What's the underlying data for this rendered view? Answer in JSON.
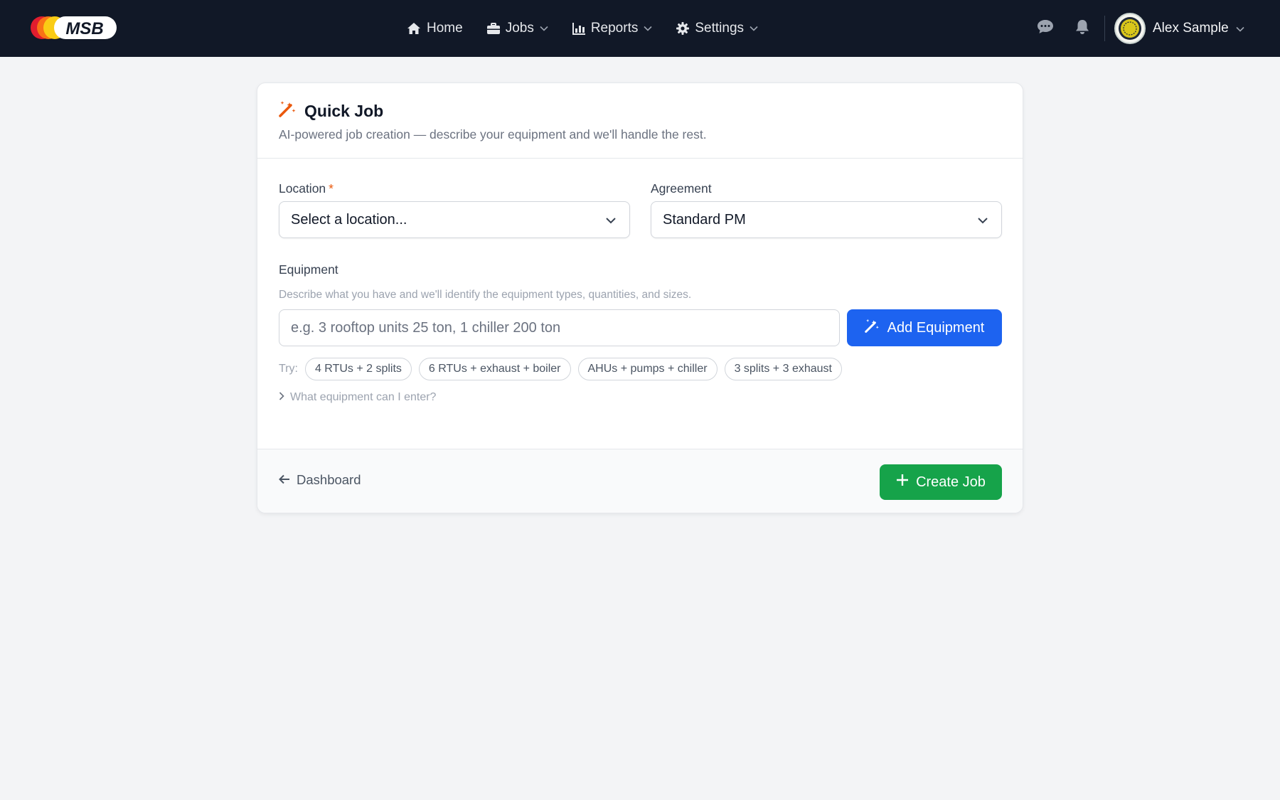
{
  "brand": {
    "logo_text": "MSB"
  },
  "nav": {
    "items": [
      {
        "label": "Home",
        "icon": "home-icon",
        "has_dropdown": false
      },
      {
        "label": "Jobs",
        "icon": "briefcase-icon",
        "has_dropdown": true
      },
      {
        "label": "Reports",
        "icon": "bar-chart-icon",
        "has_dropdown": true
      },
      {
        "label": "Settings",
        "icon": "gear-icon",
        "has_dropdown": true
      }
    ],
    "user_name": "Alex Sample"
  },
  "quick_job": {
    "title": "Quick Job",
    "subtitle": "AI-powered job creation — describe your equipment and we'll handle the rest.",
    "location": {
      "label": "Location",
      "required_mark": "*",
      "value": "Select a location..."
    },
    "agreement": {
      "label": "Agreement",
      "value": "Standard PM"
    },
    "equipment": {
      "label": "Equipment",
      "help": "Describe what you have and we'll identify the equipment types, quantities, and sizes.",
      "placeholder": "e.g. 3 rooftop units 25 ton, 1 chiller 200 ton",
      "add_button": "Add Equipment",
      "try_label": "Try:",
      "suggestions": [
        "4 RTUs + 2 splits",
        "6 RTUs + exhaust + boiler",
        "AHUs + pumps + chiller",
        "3 splits + 3 exhaust"
      ],
      "disclosure": "What equipment can I enter?"
    },
    "footer": {
      "back_label": "Dashboard",
      "create_label": "Create Job"
    }
  },
  "colors": {
    "navbar_bg": "#111827",
    "primary_blue": "#1d63f0",
    "success_green": "#16a34a",
    "accent_orange": "#ea580c"
  }
}
